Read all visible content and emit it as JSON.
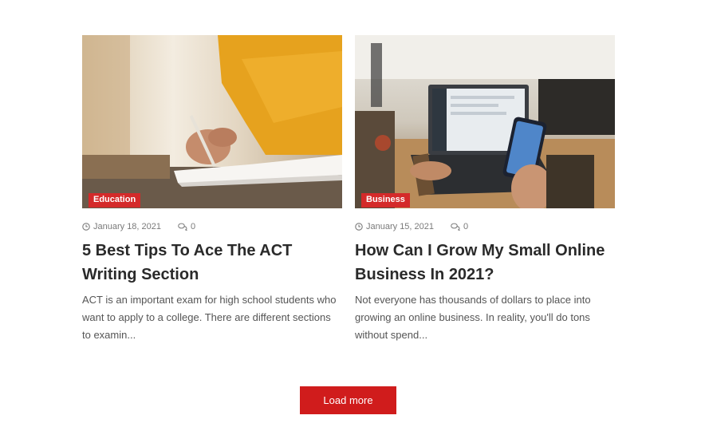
{
  "posts": [
    {
      "category": "Education",
      "date": "January 18, 2021",
      "comments": "0",
      "title": "5 Best Tips To Ace The ACT Writing Section",
      "excerpt": "ACT is an important exam for high school students who want to apply to a college. There are different sections to examin..."
    },
    {
      "category": "Business",
      "date": "January 15, 2021",
      "comments": "0",
      "title": "How Can I Grow My Small Online Business In 2021?",
      "excerpt": "Not everyone has thousands of dollars to place into growing an online business. In reality, you'll do tons without spend..."
    }
  ],
  "load_more_label": "Load more",
  "icons": {
    "date": "clock-icon",
    "comments": "comment-bubbles-icon"
  },
  "colors": {
    "accent": "#d01c1c",
    "badge": "#d42a2a",
    "meta_text": "#7a7a7a"
  }
}
